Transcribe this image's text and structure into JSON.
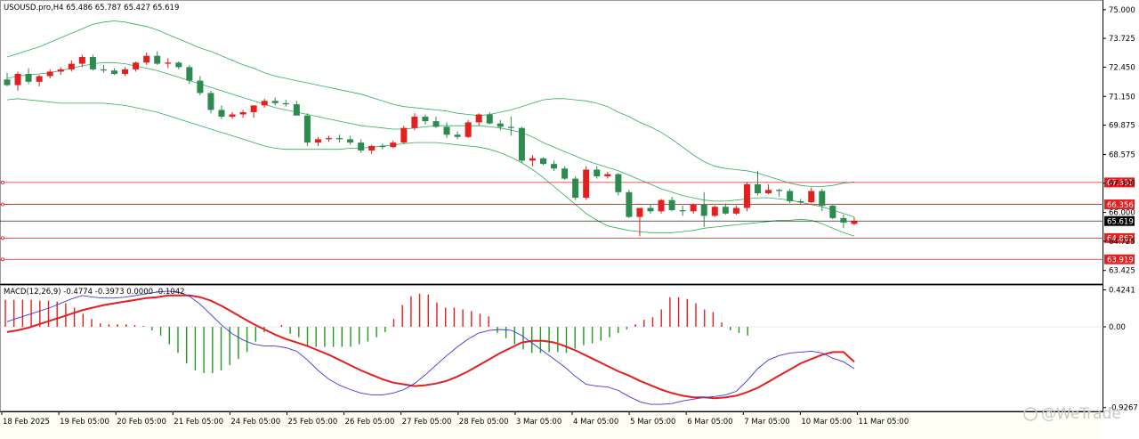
{
  "main_panel": {
    "header": "USOUSD.pro,H4  65.486 65.787 65.427 65.619"
  },
  "indicator_panel": {
    "header": "MACD(12,26,9) -0.4774 -0.3973 0.0000 -0.1042"
  },
  "watermark": "@WeTrade",
  "colors": {
    "bull": "#2e8b4f",
    "bear": "#e31f1f",
    "band": "#2fae5a",
    "level": "#e31f1f",
    "macd_line": "#e31f1f",
    "signal_line": "#3a3ad8",
    "hist_up": "#e31f1f",
    "hist_down": "#1f9a1f",
    "price_tag_bg": "#000000"
  },
  "chart_data": [
    {
      "type": "candlestick",
      "symbol": "USOUSD.pro",
      "timeframe": "H4",
      "ohlc_now": {
        "open": 65.486,
        "high": 65.787,
        "low": 65.427,
        "close": 65.619
      },
      "x_labels": [
        "18 Feb 2025",
        "19 Feb 05:00",
        "20 Feb 05:00",
        "21 Feb 05:00",
        "24 Feb 05:00",
        "25 Feb 05:00",
        "26 Feb 05:00",
        "27 Feb 05:00",
        "28 Feb 05:00",
        "3 Mar 05:00",
        "4 Mar 05:00",
        "5 Mar 05:00",
        "6 Mar 05:00",
        "7 Mar 05:00",
        "10 Mar 05:00",
        "11 Mar 05:00"
      ],
      "y_ticks": [
        "75.000",
        "73.725",
        "72.450",
        "71.150",
        "69.875",
        "68.575",
        "67.300",
        "66.000",
        "64.725",
        "63.425"
      ],
      "ylim": [
        62.9,
        75.35
      ],
      "horizontal_levels": [
        "67.331",
        "66.356",
        "64.862",
        "63.919"
      ],
      "current_price": "65.619",
      "candles": [
        [
          71.9,
          72.2,
          71.6,
          71.65
        ],
        [
          71.65,
          72.25,
          71.4,
          72.15
        ],
        [
          72.15,
          72.4,
          71.7,
          71.8
        ],
        [
          71.8,
          72.1,
          71.6,
          72.05
        ],
        [
          72.05,
          72.35,
          71.95,
          72.25
        ],
        [
          72.25,
          72.45,
          72.1,
          72.35
        ],
        [
          72.35,
          72.75,
          72.25,
          72.6
        ],
        [
          72.6,
          73.0,
          72.45,
          72.9
        ],
        [
          72.9,
          73.0,
          72.3,
          72.35
        ],
        [
          72.35,
          72.55,
          72.2,
          72.3
        ],
        [
          72.3,
          72.4,
          72.1,
          72.15
        ],
        [
          72.15,
          72.45,
          72.05,
          72.35
        ],
        [
          72.35,
          72.7,
          72.25,
          72.65
        ],
        [
          72.65,
          73.1,
          72.55,
          72.95
        ],
        [
          72.95,
          73.15,
          72.55,
          72.6
        ],
        [
          72.6,
          72.85,
          72.4,
          72.65
        ],
        [
          72.65,
          72.7,
          72.35,
          72.45
        ],
        [
          72.45,
          72.55,
          71.7,
          71.85
        ],
        [
          71.85,
          72.05,
          71.2,
          71.3
        ],
        [
          71.3,
          71.4,
          70.4,
          70.55
        ],
        [
          70.55,
          70.75,
          70.15,
          70.25
        ],
        [
          70.25,
          70.45,
          70.15,
          70.35
        ],
        [
          70.35,
          70.55,
          70.2,
          70.45
        ],
        [
          70.45,
          70.75,
          70.2,
          70.75
        ],
        [
          70.75,
          71.05,
          70.65,
          70.95
        ],
        [
          70.95,
          71.1,
          70.75,
          70.85
        ],
        [
          70.85,
          71.0,
          70.7,
          70.8
        ],
        [
          70.8,
          70.95,
          70.5,
          70.3
        ],
        [
          70.3,
          70.4,
          68.95,
          69.1
        ],
        [
          69.1,
          69.35,
          68.95,
          69.25
        ],
        [
          69.25,
          69.4,
          69.15,
          69.3
        ],
        [
          69.3,
          69.45,
          69.1,
          69.25
        ],
        [
          69.25,
          69.4,
          69.0,
          69.1
        ],
        [
          69.1,
          69.25,
          68.65,
          68.75
        ],
        [
          68.75,
          69.0,
          68.6,
          68.95
        ],
        [
          68.95,
          69.05,
          68.8,
          68.9
        ],
        [
          68.9,
          69.2,
          68.85,
          69.1
        ],
        [
          69.1,
          69.85,
          69.05,
          69.75
        ],
        [
          69.75,
          70.4,
          69.65,
          70.25
        ],
        [
          70.25,
          70.35,
          69.9,
          70.05
        ],
        [
          70.05,
          70.25,
          69.75,
          69.8
        ],
        [
          69.8,
          70.0,
          69.3,
          69.45
        ],
        [
          69.45,
          69.6,
          69.25,
          69.35
        ],
        [
          69.35,
          70.1,
          69.3,
          70.0
        ],
        [
          70.0,
          70.4,
          69.85,
          70.35
        ],
        [
          70.35,
          70.45,
          69.9,
          69.95
        ],
        [
          69.95,
          70.1,
          69.65,
          69.8
        ],
        [
          69.8,
          70.25,
          69.4,
          69.75
        ],
        [
          69.75,
          69.8,
          68.2,
          68.3
        ],
        [
          68.3,
          68.55,
          68.05,
          68.4
        ],
        [
          68.4,
          68.45,
          68.1,
          68.15
        ],
        [
          68.15,
          68.3,
          67.85,
          67.95
        ],
        [
          67.95,
          68.05,
          67.45,
          67.5
        ],
        [
          67.5,
          67.6,
          66.55,
          66.65
        ],
        [
          66.65,
          68.05,
          66.55,
          67.9
        ],
        [
          67.9,
          68.05,
          67.5,
          67.6
        ],
        [
          67.6,
          67.8,
          67.5,
          67.7
        ],
        [
          67.7,
          67.75,
          66.75,
          66.9
        ],
        [
          66.9,
          67.0,
          65.75,
          65.8
        ],
        [
          65.8,
          66.15,
          64.95,
          66.2
        ],
        [
          66.2,
          66.35,
          65.95,
          66.05
        ],
        [
          66.05,
          66.6,
          65.95,
          66.55
        ],
        [
          66.55,
          66.7,
          66.05,
          66.1
        ],
        [
          66.1,
          66.3,
          65.85,
          66.05
        ],
        [
          66.05,
          66.4,
          65.95,
          66.35
        ],
        [
          66.35,
          66.9,
          65.35,
          65.85
        ],
        [
          65.85,
          66.3,
          65.8,
          66.25
        ],
        [
          66.25,
          66.4,
          65.9,
          65.95
        ],
        [
          65.95,
          66.3,
          65.9,
          66.2
        ],
        [
          66.2,
          67.35,
          66.05,
          67.25
        ],
        [
          67.25,
          67.85,
          66.75,
          66.85
        ],
        [
          66.85,
          67.25,
          66.8,
          67.0
        ],
        [
          67.0,
          67.05,
          66.7,
          66.95
        ],
        [
          66.95,
          67.05,
          66.4,
          66.5
        ],
        [
          66.5,
          66.6,
          66.35,
          66.45
        ],
        [
          66.45,
          67.1,
          66.4,
          66.95
        ],
        [
          66.95,
          67.05,
          66.05,
          66.3
        ],
        [
          66.3,
          66.35,
          65.7,
          65.75
        ],
        [
          65.75,
          65.9,
          65.3,
          65.55
        ],
        [
          65.49,
          65.79,
          65.43,
          65.62
        ]
      ],
      "bollinger": {
        "upper": [
          72.9,
          73.05,
          73.2,
          73.35,
          73.55,
          73.75,
          73.95,
          74.15,
          74.35,
          74.45,
          74.5,
          74.45,
          74.35,
          74.25,
          74.1,
          73.9,
          73.7,
          73.5,
          73.3,
          73.15,
          72.95,
          72.75,
          72.55,
          72.4,
          72.2,
          72.05,
          71.95,
          71.85,
          71.75,
          71.65,
          71.55,
          71.45,
          71.35,
          71.25,
          71.1,
          70.95,
          70.8,
          70.7,
          70.65,
          70.6,
          70.55,
          70.5,
          70.4,
          70.35,
          70.3,
          70.35,
          70.45,
          70.55,
          70.7,
          70.85,
          71.0,
          71.05,
          71.05,
          71.0,
          70.95,
          70.85,
          70.7,
          70.45,
          70.25,
          70.0,
          69.8,
          69.55,
          69.25,
          68.9,
          68.55,
          68.25,
          68.05,
          67.95,
          67.9,
          67.85,
          67.75,
          67.6,
          67.45,
          67.3,
          67.2,
          67.15,
          67.15,
          67.2,
          67.3,
          67.35
        ],
        "middle": [
          71.95,
          72.05,
          72.1,
          72.15,
          72.2,
          72.3,
          72.4,
          72.5,
          72.6,
          72.65,
          72.65,
          72.6,
          72.5,
          72.4,
          72.3,
          72.15,
          72.0,
          71.85,
          71.7,
          71.55,
          71.4,
          71.25,
          71.1,
          70.95,
          70.8,
          70.65,
          70.55,
          70.45,
          70.35,
          70.25,
          70.15,
          70.05,
          69.95,
          69.85,
          69.8,
          69.75,
          69.7,
          69.7,
          69.75,
          69.8,
          69.85,
          69.85,
          69.85,
          69.85,
          69.85,
          69.8,
          69.75,
          69.65,
          69.55,
          69.35,
          69.1,
          68.9,
          68.7,
          68.5,
          68.3,
          68.15,
          68.0,
          67.85,
          67.65,
          67.45,
          67.25,
          67.05,
          66.9,
          66.75,
          66.65,
          66.55,
          66.5,
          66.5,
          66.55,
          66.6,
          66.65,
          66.65,
          66.6,
          66.55,
          66.45,
          66.35,
          66.25,
          66.1,
          65.95,
          65.8
        ],
        "lower": [
          71.0,
          71.05,
          71.0,
          70.95,
          70.9,
          70.85,
          70.85,
          70.85,
          70.85,
          70.85,
          70.8,
          70.75,
          70.65,
          70.55,
          70.45,
          70.3,
          70.15,
          70.0,
          69.85,
          69.7,
          69.55,
          69.4,
          69.25,
          69.1,
          68.95,
          68.85,
          68.8,
          68.8,
          68.8,
          68.8,
          68.8,
          68.8,
          68.85,
          68.85,
          68.9,
          68.95,
          69.0,
          69.05,
          69.1,
          69.1,
          69.1,
          69.05,
          69.0,
          68.95,
          68.9,
          68.8,
          68.65,
          68.45,
          68.2,
          67.9,
          67.55,
          67.15,
          66.75,
          66.35,
          65.95,
          65.65,
          65.4,
          65.3,
          65.2,
          65.15,
          65.1,
          65.1,
          65.1,
          65.15,
          65.2,
          65.3,
          65.35,
          65.4,
          65.45,
          65.5,
          65.55,
          65.6,
          65.65,
          65.65,
          65.7,
          65.65,
          65.5,
          65.3,
          65.1,
          64.95
        ]
      }
    },
    {
      "type": "macd",
      "title": "MACD(12,26,9)",
      "values": {
        "main": "-0.4774",
        "signal": "-0.3973",
        "zero": "0.0000",
        "hist": "-0.1042"
      },
      "y_ticks": [
        "0.4241",
        "0.00",
        "-0.9267"
      ],
      "ylim": [
        -0.96,
        0.46
      ],
      "main_line": [
        0.06,
        0.1,
        0.14,
        0.18,
        0.22,
        0.27,
        0.32,
        0.36,
        0.34,
        0.33,
        0.33,
        0.34,
        0.36,
        0.38,
        0.4,
        0.41,
        0.4,
        0.35,
        0.26,
        0.14,
        0.02,
        -0.08,
        -0.15,
        -0.2,
        -0.22,
        -0.22,
        -0.24,
        -0.28,
        -0.38,
        -0.5,
        -0.6,
        -0.67,
        -0.72,
        -0.76,
        -0.78,
        -0.78,
        -0.76,
        -0.72,
        -0.65,
        -0.55,
        -0.44,
        -0.33,
        -0.23,
        -0.14,
        -0.07,
        -0.04,
        -0.03,
        -0.04,
        -0.1,
        -0.19,
        -0.28,
        -0.37,
        -0.46,
        -0.57,
        -0.66,
        -0.68,
        -0.69,
        -0.73,
        -0.8,
        -0.86,
        -0.89,
        -0.89,
        -0.88,
        -0.85,
        -0.83,
        -0.81,
        -0.8,
        -0.78,
        -0.74,
        -0.62,
        -0.48,
        -0.38,
        -0.33,
        -0.3,
        -0.29,
        -0.28,
        -0.3,
        -0.36,
        -0.4,
        -0.48
      ],
      "signal_line": [
        -0.06,
        -0.04,
        -0.01,
        0.03,
        0.07,
        0.11,
        0.15,
        0.19,
        0.22,
        0.25,
        0.27,
        0.29,
        0.31,
        0.33,
        0.34,
        0.36,
        0.36,
        0.36,
        0.34,
        0.3,
        0.24,
        0.17,
        0.1,
        0.03,
        -0.03,
        -0.09,
        -0.14,
        -0.18,
        -0.22,
        -0.27,
        -0.32,
        -0.38,
        -0.44,
        -0.5,
        -0.55,
        -0.6,
        -0.64,
        -0.66,
        -0.68,
        -0.67,
        -0.65,
        -0.62,
        -0.57,
        -0.51,
        -0.44,
        -0.37,
        -0.3,
        -0.24,
        -0.18,
        -0.16,
        -0.16,
        -0.18,
        -0.22,
        -0.27,
        -0.33,
        -0.39,
        -0.45,
        -0.51,
        -0.56,
        -0.62,
        -0.67,
        -0.72,
        -0.76,
        -0.79,
        -0.81,
        -0.81,
        -0.82,
        -0.81,
        -0.79,
        -0.75,
        -0.7,
        -0.63,
        -0.56,
        -0.49,
        -0.42,
        -0.37,
        -0.32,
        -0.29,
        -0.29,
        -0.4
      ],
      "histogram": [
        0.31,
        0.31,
        0.31,
        0.31,
        0.3,
        0.3,
        0.29,
        0.27,
        0.22,
        0.15,
        0.09,
        0.04,
        0.03,
        0.03,
        0.03,
        0.02,
        0.01,
        -0.04,
        -0.1,
        -0.2,
        -0.3,
        -0.42,
        -0.5,
        -0.53,
        -0.53,
        -0.5,
        -0.44,
        -0.37,
        -0.29,
        -0.17,
        -0.06,
        0.0,
        0.02,
        -0.08,
        -0.12,
        -0.23,
        -0.23,
        -0.23,
        -0.23,
        -0.23,
        -0.23,
        -0.2,
        -0.17,
        -0.12,
        -0.06,
        0.09,
        0.25,
        0.35,
        0.38,
        0.37,
        0.28,
        0.22,
        0.22,
        0.2,
        0.18,
        0.15,
        0.12,
        -0.07,
        -0.13,
        -0.2,
        -0.26,
        -0.3,
        -0.3,
        -0.29,
        -0.29,
        -0.3,
        -0.25,
        -0.21,
        -0.19,
        -0.16,
        -0.12,
        -0.07,
        -0.03,
        0.03,
        0.08,
        0.11,
        0.2,
        0.34,
        0.34,
        0.32,
        0.27,
        0.2,
        0.17,
        0.05,
        -0.04,
        -0.07,
        -0.1
      ]
    }
  ]
}
